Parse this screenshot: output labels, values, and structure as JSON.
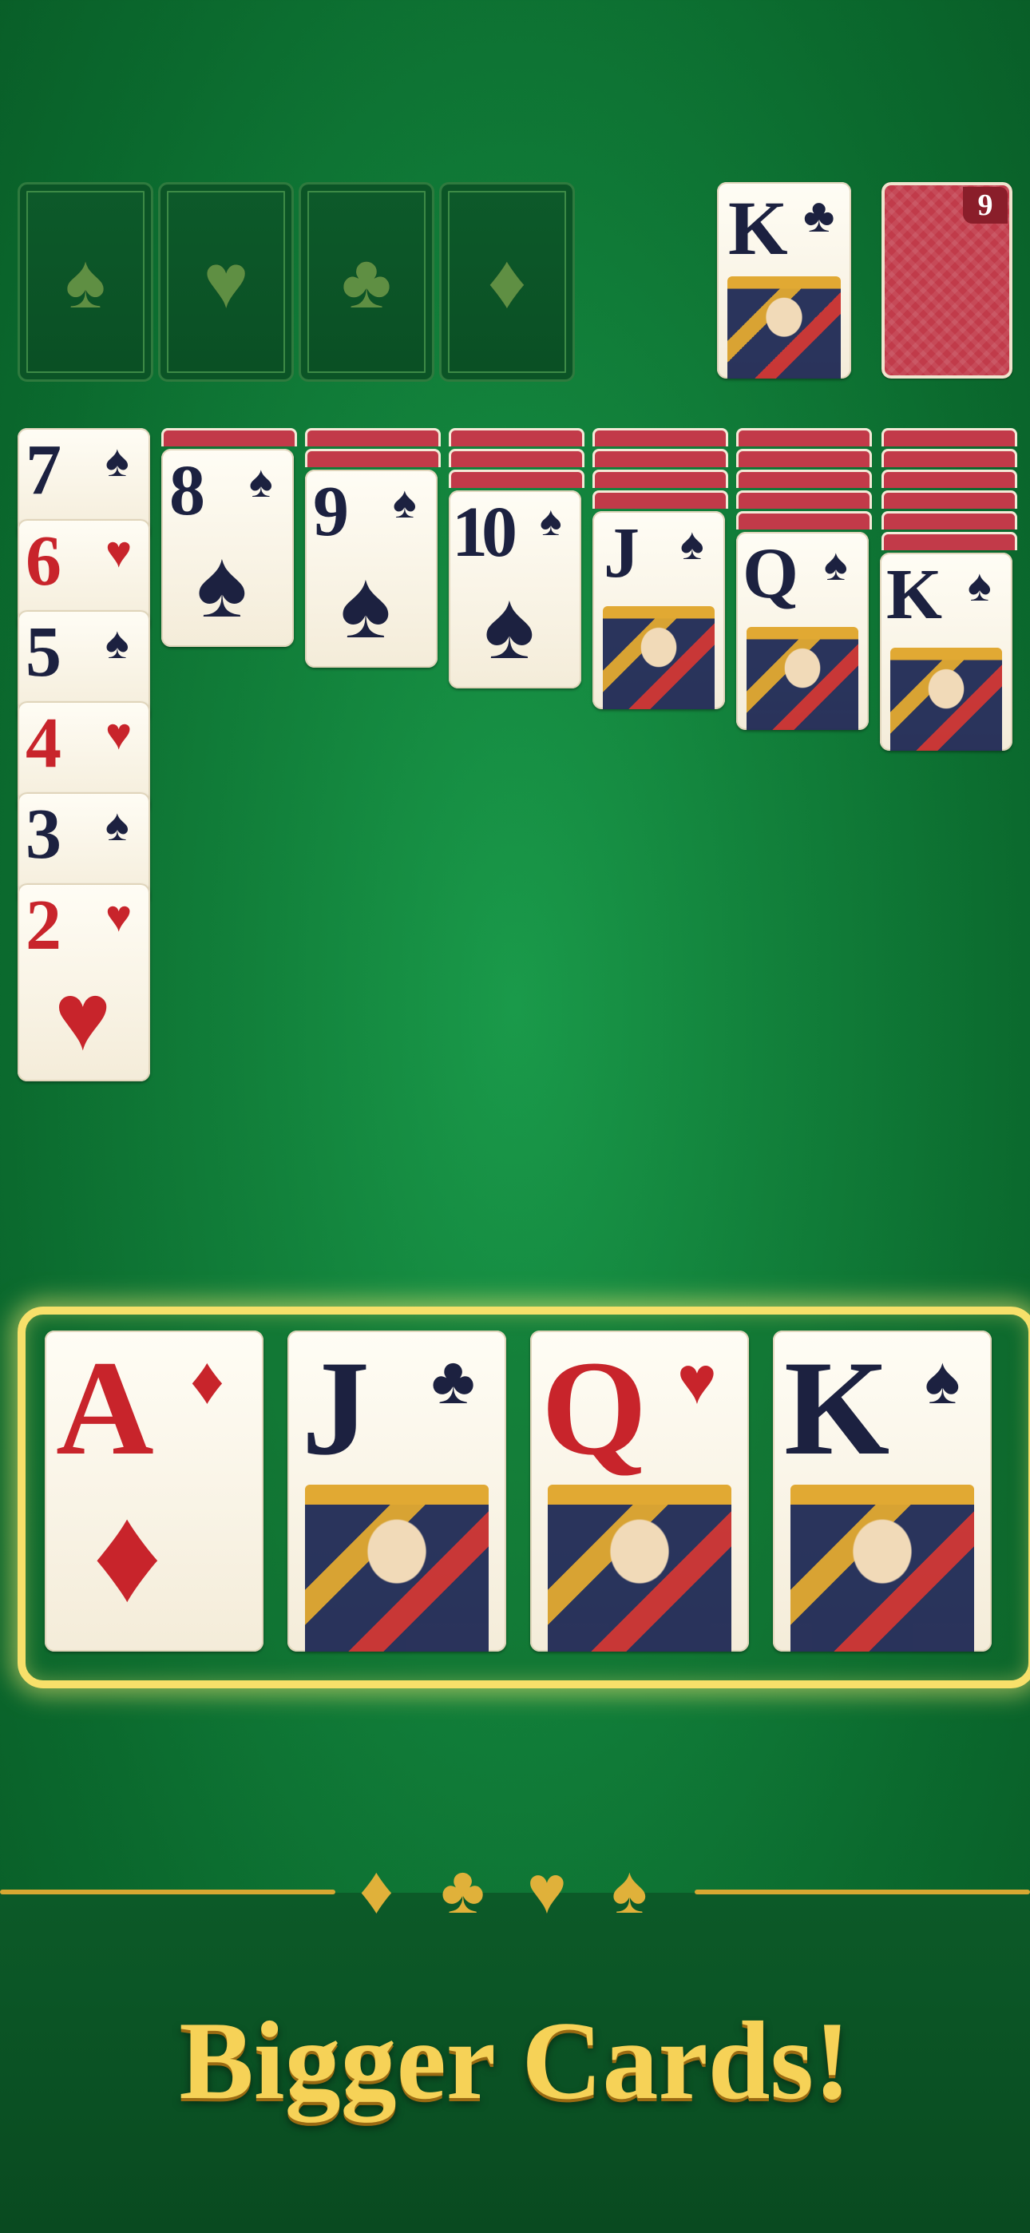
{
  "foundations": [
    {
      "suit": "♠"
    },
    {
      "suit": "♥"
    },
    {
      "suit": "♣"
    },
    {
      "suit": "♦"
    }
  ],
  "waste": {
    "rank": "K",
    "suit": "♣"
  },
  "stock": {
    "count": "9"
  },
  "tableau": {
    "col1": [
      {
        "rank": "7",
        "suit": "♠"
      },
      {
        "rank": "6",
        "suit": "♥"
      },
      {
        "rank": "5",
        "suit": "♠"
      },
      {
        "rank": "4",
        "suit": "♥"
      },
      {
        "rank": "3",
        "suit": "♠"
      },
      {
        "rank": "2",
        "suit": "♥"
      }
    ],
    "col2": {
      "rank": "8",
      "suit": "♠"
    },
    "col3": {
      "rank": "9",
      "suit": "♠"
    },
    "col4": {
      "rank": "10",
      "suit": "♠"
    },
    "col5": {
      "rank": "J",
      "suit": "♠"
    },
    "col6": {
      "rank": "Q",
      "suit": "♠"
    },
    "col7": {
      "rank": "K",
      "suit": "♠"
    }
  },
  "featured": [
    {
      "rank": "A",
      "suit": "♦"
    },
    {
      "rank": "J",
      "suit": "♣"
    },
    {
      "rank": "Q",
      "suit": "♥"
    },
    {
      "rank": "K",
      "suit": "♠"
    }
  ],
  "ornaments": {
    "diamond": "♦",
    "club": "♣",
    "heart": "♥",
    "spade": "♠"
  },
  "colors": {
    "felt": "#12813b",
    "gold": "#f6d257",
    "red": "#c8242b",
    "black": "#1c2140"
  },
  "title": "Bigger Cards!"
}
